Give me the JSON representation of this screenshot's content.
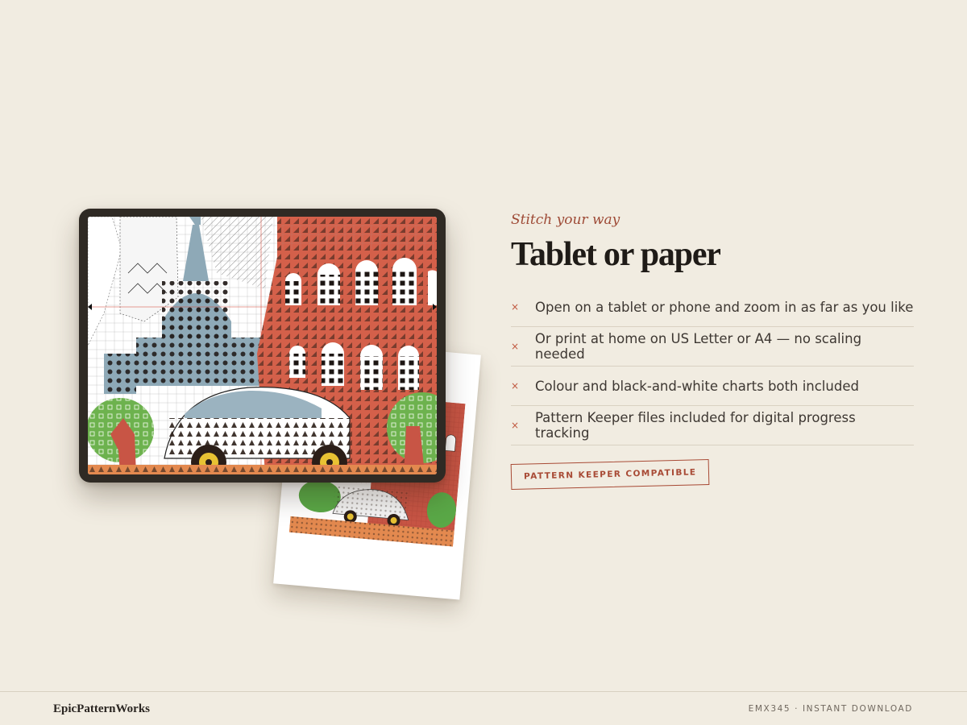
{
  "hero": {
    "eyebrow": "Stitch your way",
    "title": "Tablet or paper"
  },
  "features": [
    {
      "bullet": "×",
      "text": "Open on a tablet or phone and zoom in as far as you like"
    },
    {
      "bullet": "×",
      "text": "Or print at home on US Letter or A4 — no scaling needed"
    },
    {
      "bullet": "×",
      "text": "Colour and black-and-white charts both included"
    },
    {
      "bullet": "×",
      "text": "Pattern Keeper files included for digital progress tracking"
    }
  ],
  "badge": "PATTERN KEEPER COMPATIBLE",
  "footer": {
    "brand": "EpicPatternWorks",
    "sku": "EMX345 · INSTANT DOWNLOAD"
  },
  "colors": {
    "background": "#f1ece1",
    "accent": "#a84a35",
    "chart_red": "#d4604a",
    "chart_blue": "#8ea9b7",
    "chart_green": "#6db24e",
    "chart_orange": "#e3894f",
    "device_frame": "#2f2a24"
  },
  "illustration": {
    "device": "tablet-icon",
    "printout": "paper-sheet"
  }
}
